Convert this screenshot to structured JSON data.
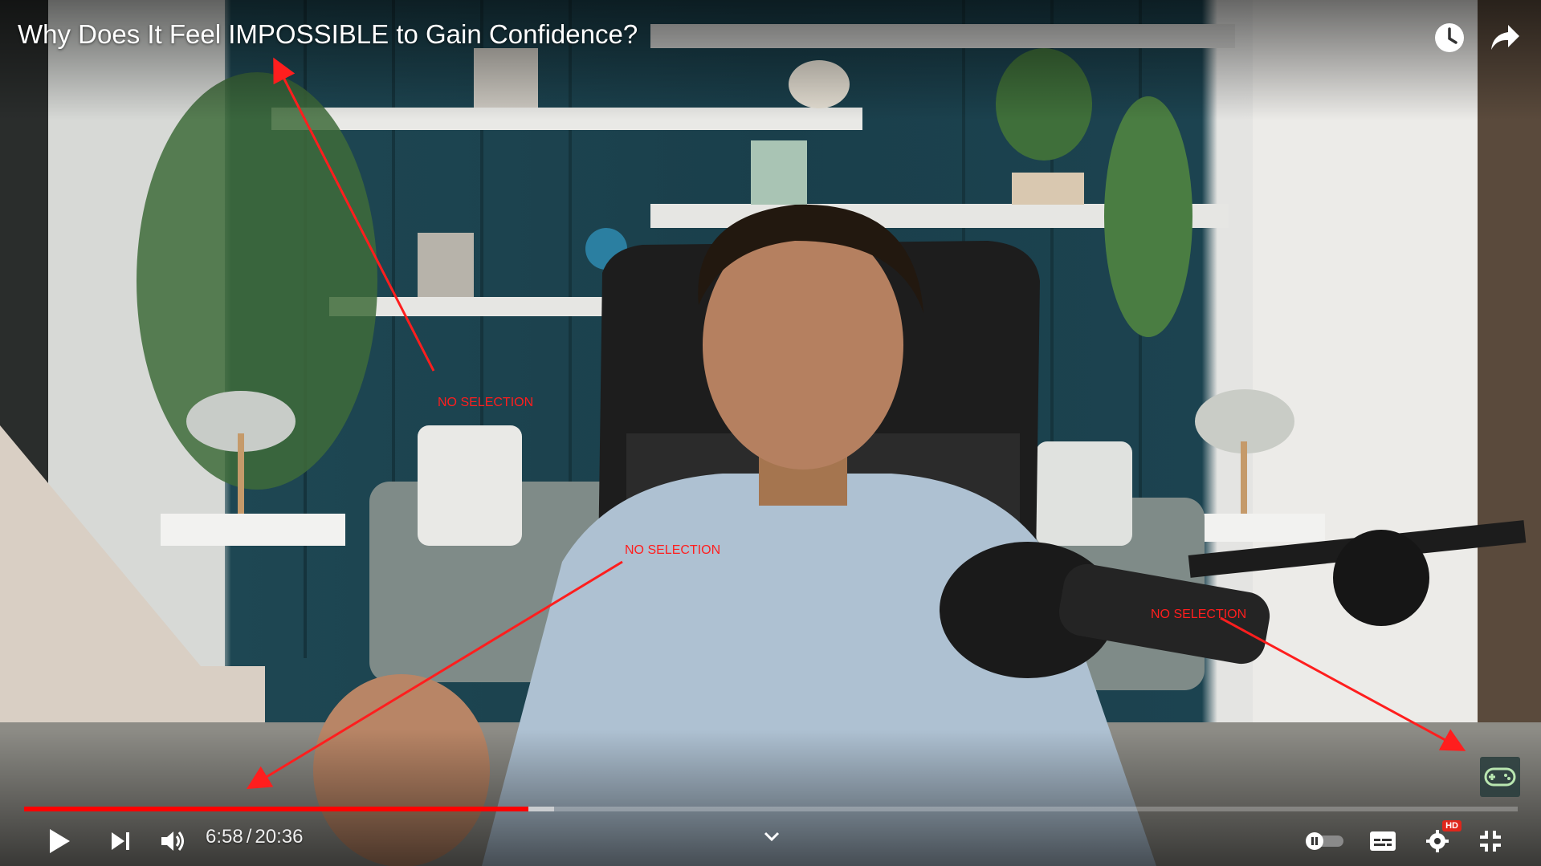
{
  "video": {
    "title": "Why Does It Feel IMPOSSIBLE to Gain Confidence?",
    "progress_fraction": 0.3378,
    "buffered_fraction": 0.355
  },
  "header": {
    "watch_later_icon": "clock-icon",
    "share_icon": "share-arrow-icon"
  },
  "controls": {
    "play_icon": "play-icon",
    "next_icon": "next-icon",
    "volume_icon": "volume-icon",
    "current_time": "6:58",
    "separator": "/",
    "duration": "20:36",
    "chapter_chevron_icon": "chevron-down-icon",
    "autoplay_toggle_icon": "autoplay-toggle-icon",
    "subtitles_icon": "subtitles-icon",
    "settings_icon": "gear-icon",
    "hd_badge": "HD",
    "exit_fullscreen_icon": "exit-fullscreen-icon",
    "game_controller_icon": "game-controller-icon"
  },
  "annotations": {
    "label_1": "NO SELECTION",
    "label_2": "NO SELECTION",
    "label_3": "NO SELECTION",
    "color": "#ff1e1e"
  },
  "colors": {
    "progress_played": "#ff0000",
    "hd_badge": "#e0261b"
  }
}
